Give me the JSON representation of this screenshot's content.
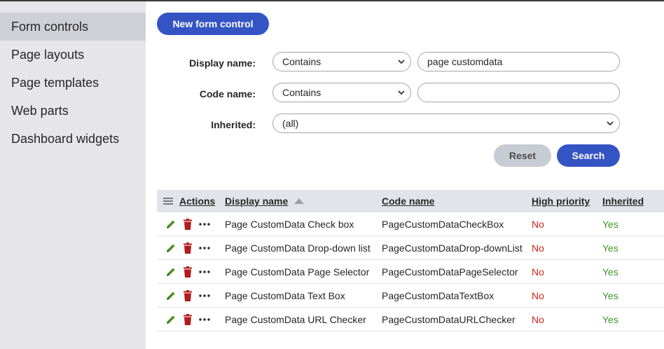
{
  "sidebar": {
    "items": [
      {
        "label": "Form controls",
        "active": true
      },
      {
        "label": "Page layouts"
      },
      {
        "label": "Page templates"
      },
      {
        "label": "Web parts"
      },
      {
        "label": "Dashboard widgets"
      }
    ]
  },
  "toolbar": {
    "new_label": "New form control"
  },
  "filters": {
    "display_name": {
      "label": "Display name:",
      "operator": "Contains",
      "value": "page customdata"
    },
    "code_name": {
      "label": "Code name:",
      "operator": "Contains",
      "value": ""
    },
    "inherited": {
      "label": "Inherited:",
      "value": "(all)"
    },
    "reset_label": "Reset",
    "search_label": "Search"
  },
  "grid": {
    "columns": {
      "actions": "Actions",
      "display_name": "Display name",
      "code_name": "Code name",
      "high_priority": "High priority",
      "inherited": "Inherited"
    },
    "sort": {
      "column": "display_name",
      "direction": "ascending"
    },
    "rows": [
      {
        "display_name": "Page CustomData Check box",
        "code_name": "PageCustomDataCheckBox",
        "high_priority": "No",
        "inherited": "Yes"
      },
      {
        "display_name": "Page CustomData Drop-down list",
        "code_name": "PageCustomDataDrop-downList",
        "high_priority": "No",
        "inherited": "Yes"
      },
      {
        "display_name": "Page CustomData Page Selector",
        "code_name": "PageCustomDataPageSelector",
        "high_priority": "No",
        "inherited": "Yes"
      },
      {
        "display_name": "Page CustomData Text Box",
        "code_name": "PageCustomDataTextBox",
        "high_priority": "No",
        "inherited": "Yes"
      },
      {
        "display_name": "Page CustomData URL Checker",
        "code_name": "PageCustomDataURLChecker",
        "high_priority": "No",
        "inherited": "Yes"
      }
    ],
    "row_icons": [
      "edit-icon",
      "delete-icon",
      "more-icon"
    ]
  },
  "colors": {
    "accent": "#3454c4",
    "no": "#d0261b",
    "yes": "#3a9b23",
    "edit": "#4a8f1d",
    "delete": "#b31c1c"
  }
}
